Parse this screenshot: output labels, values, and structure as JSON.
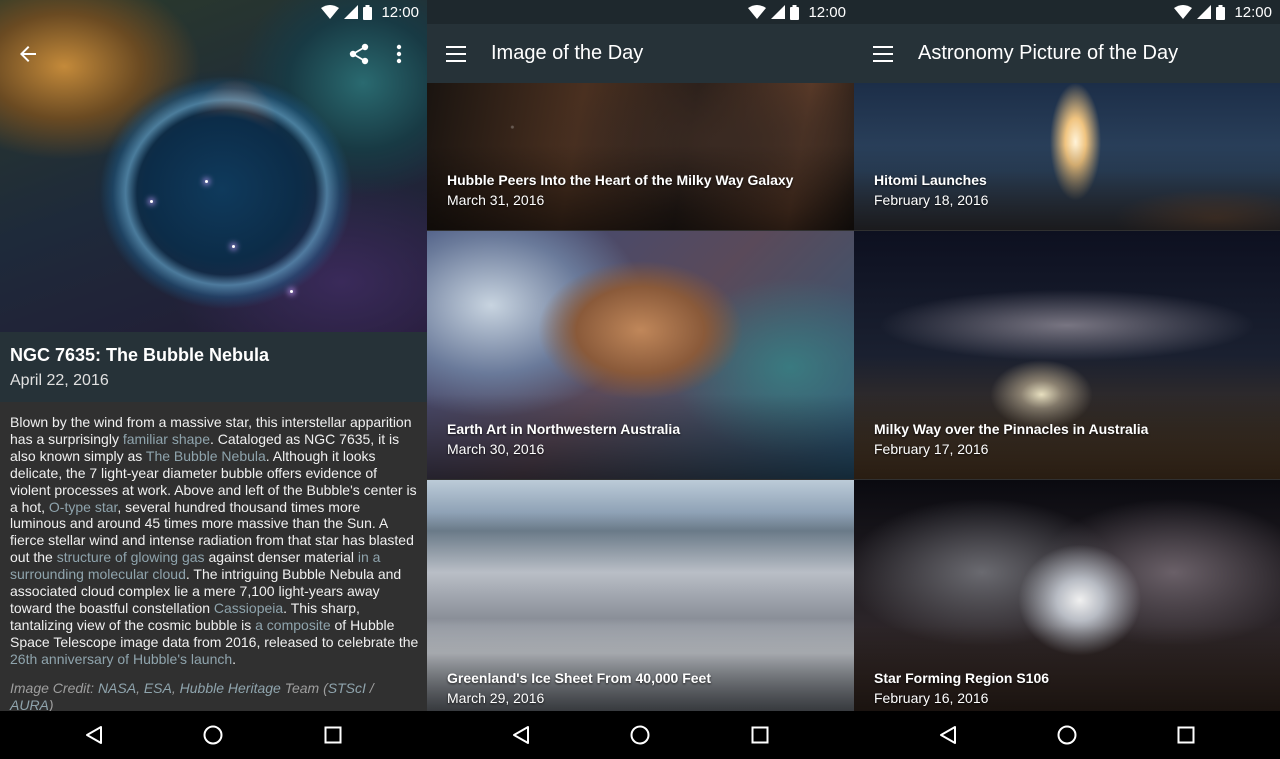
{
  "status_bar": {
    "time": "12:00"
  },
  "screen1": {
    "title": "NGC 7635: The Bubble Nebula",
    "date": "April 22, 2016",
    "description": [
      {
        "text": "Blown by the wind from a massive star, this interstellar apparition has a surprisingly ",
        "link": false
      },
      {
        "text": "familiar shape",
        "link": true
      },
      {
        "text": ". Cataloged as NGC 7635, it is also known simply as ",
        "link": false
      },
      {
        "text": "The Bubble Nebula",
        "link": true
      },
      {
        "text": ". Although it looks delicate, the 7 light-year diameter bubble offers evidence of violent processes at work. Above and left of the Bubble's center is a hot, ",
        "link": false
      },
      {
        "text": "O-type star",
        "link": true
      },
      {
        "text": ", several hundred thousand times more luminous and around 45 times more massive than the Sun. A fierce stellar wind and intense radiation from that star has blasted out the ",
        "link": false
      },
      {
        "text": "structure of glowing gas",
        "link": true
      },
      {
        "text": " against denser material ",
        "link": false
      },
      {
        "text": "in a surrounding molecular cloud",
        "link": true
      },
      {
        "text": ". The intriguing Bubble Nebula and associated cloud complex lie a mere 7,100 light-years away toward the boastful constellation ",
        "link": false
      },
      {
        "text": "Cassiopeia",
        "link": true
      },
      {
        "text": ". This sharp, tantalizing view of the cosmic bubble is ",
        "link": false
      },
      {
        "text": "a composite",
        "link": true
      },
      {
        "text": " of Hubble Space Telescope image data from 2016, released to celebrate the ",
        "link": false
      },
      {
        "text": "26th anniversary of Hubble's launch",
        "link": true
      },
      {
        "text": ".",
        "link": false
      }
    ],
    "credit": [
      {
        "text": "Image Credit: ",
        "link": false
      },
      {
        "text": "NASA",
        "link": true
      },
      {
        "text": ", ",
        "link": false
      },
      {
        "text": "ESA",
        "link": true
      },
      {
        "text": ", ",
        "link": false
      },
      {
        "text": "Hubble Heritage",
        "link": true
      },
      {
        "text": " Team (",
        "link": false
      },
      {
        "text": "STScI",
        "link": true
      },
      {
        "text": " / ",
        "link": false
      },
      {
        "text": "AURA",
        "link": true
      },
      {
        "text": ")",
        "link": false
      }
    ]
  },
  "screen2": {
    "toolbar_title": "Image of the Day",
    "items": [
      {
        "title": "Hubble Peers Into the Heart of the Milky Way Galaxy",
        "date": "March 31, 2016"
      },
      {
        "title": "Earth Art in Northwestern Australia",
        "date": "March 30, 2016"
      },
      {
        "title": "Greenland's Ice Sheet From 40,000 Feet",
        "date": "March 29, 2016"
      }
    ]
  },
  "screen3": {
    "toolbar_title": "Astronomy Picture of the Day",
    "items": [
      {
        "title": "Hitomi Launches",
        "date": "February 18, 2016"
      },
      {
        "title": "Milky Way over the Pinnacles in Australia",
        "date": "February 17, 2016"
      },
      {
        "title": "Star Forming Region S106",
        "date": "February 16, 2016"
      }
    ]
  },
  "icons": {
    "status": [
      "wifi-icon",
      "signal-icon",
      "battery-icon"
    ],
    "detail_appbar": [
      "back-arrow-icon",
      "share-icon",
      "more-vert-icon"
    ],
    "toolbar": [
      "menu-icon"
    ],
    "navbar": [
      "back-triangle-icon",
      "home-circle-icon",
      "recents-square-icon"
    ]
  },
  "colors": {
    "toolbar": "#263238",
    "background": "#303030",
    "link": "#8fa4ad"
  }
}
